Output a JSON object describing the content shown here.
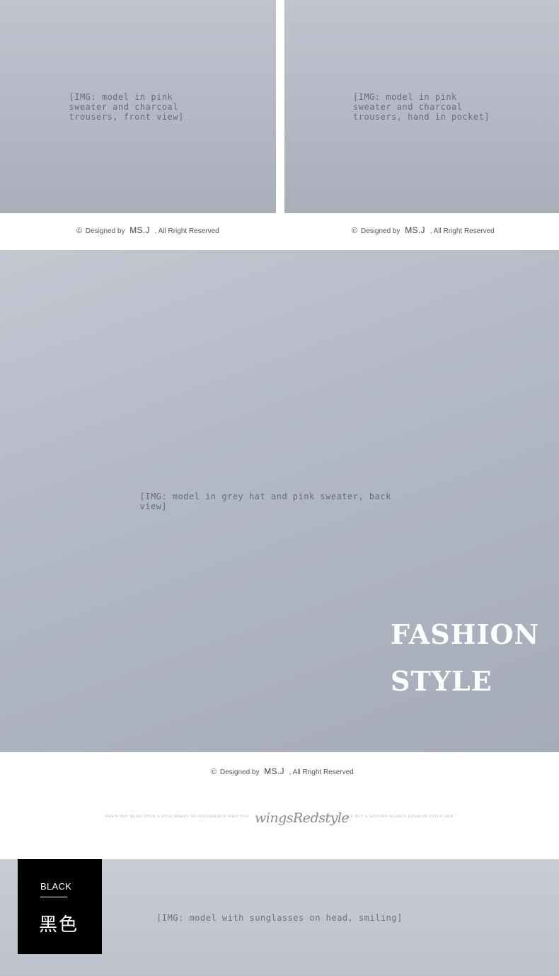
{
  "section_top": {
    "photo_left_label": "[IMG: model in pink sweater and charcoal trousers, front view]",
    "photo_right_label": "[IMG: model in pink sweater and charcoal trousers, hand in pocket]",
    "credit_left": {
      "copyright_symbol": "©",
      "prefix": "Designed by",
      "brand": "MS.J",
      "suffix": ", All Rright Reserved"
    },
    "credit_right": {
      "copyright_symbol": "©",
      "prefix": "Designed by",
      "brand": "MS.J",
      "suffix": ", All Rright Reserved"
    }
  },
  "section_main": {
    "photo_label": "[IMG: model in grey hat and pink sweater, back view]",
    "headline_line_1": "FASHION",
    "headline_line_2": "STYLE",
    "credit": {
      "copyright_symbol": "©",
      "prefix": "Designed by",
      "brand": "MS.J",
      "suffix": ", All Rright Reserved"
    }
  },
  "brand_banner": {
    "logo_text": "wingsRedstyle",
    "fine_print_left": "WHEN YOU WISH UPON A STAR MAKES NO DIFFERENCE WHO YOU ARE ANYTHING YOUR HEART DESIRES WILL COME TO YOU",
    "fine_print_right": "AND WHAT IS LOVE BUT A SECOND GLANCE FASHION STYLE AND THE WOMEN YOU KNOW ARE ALWAYS CREATION"
  },
  "section_bottom": {
    "photo_label": "[IMG: model with sunglasses on head, smiling]",
    "color_badge": {
      "english": "BLACK",
      "chinese": "黑色"
    }
  },
  "colors": {
    "badge_background": "#000000",
    "headline_text": "#ffffff",
    "credit_text": "#555555"
  }
}
